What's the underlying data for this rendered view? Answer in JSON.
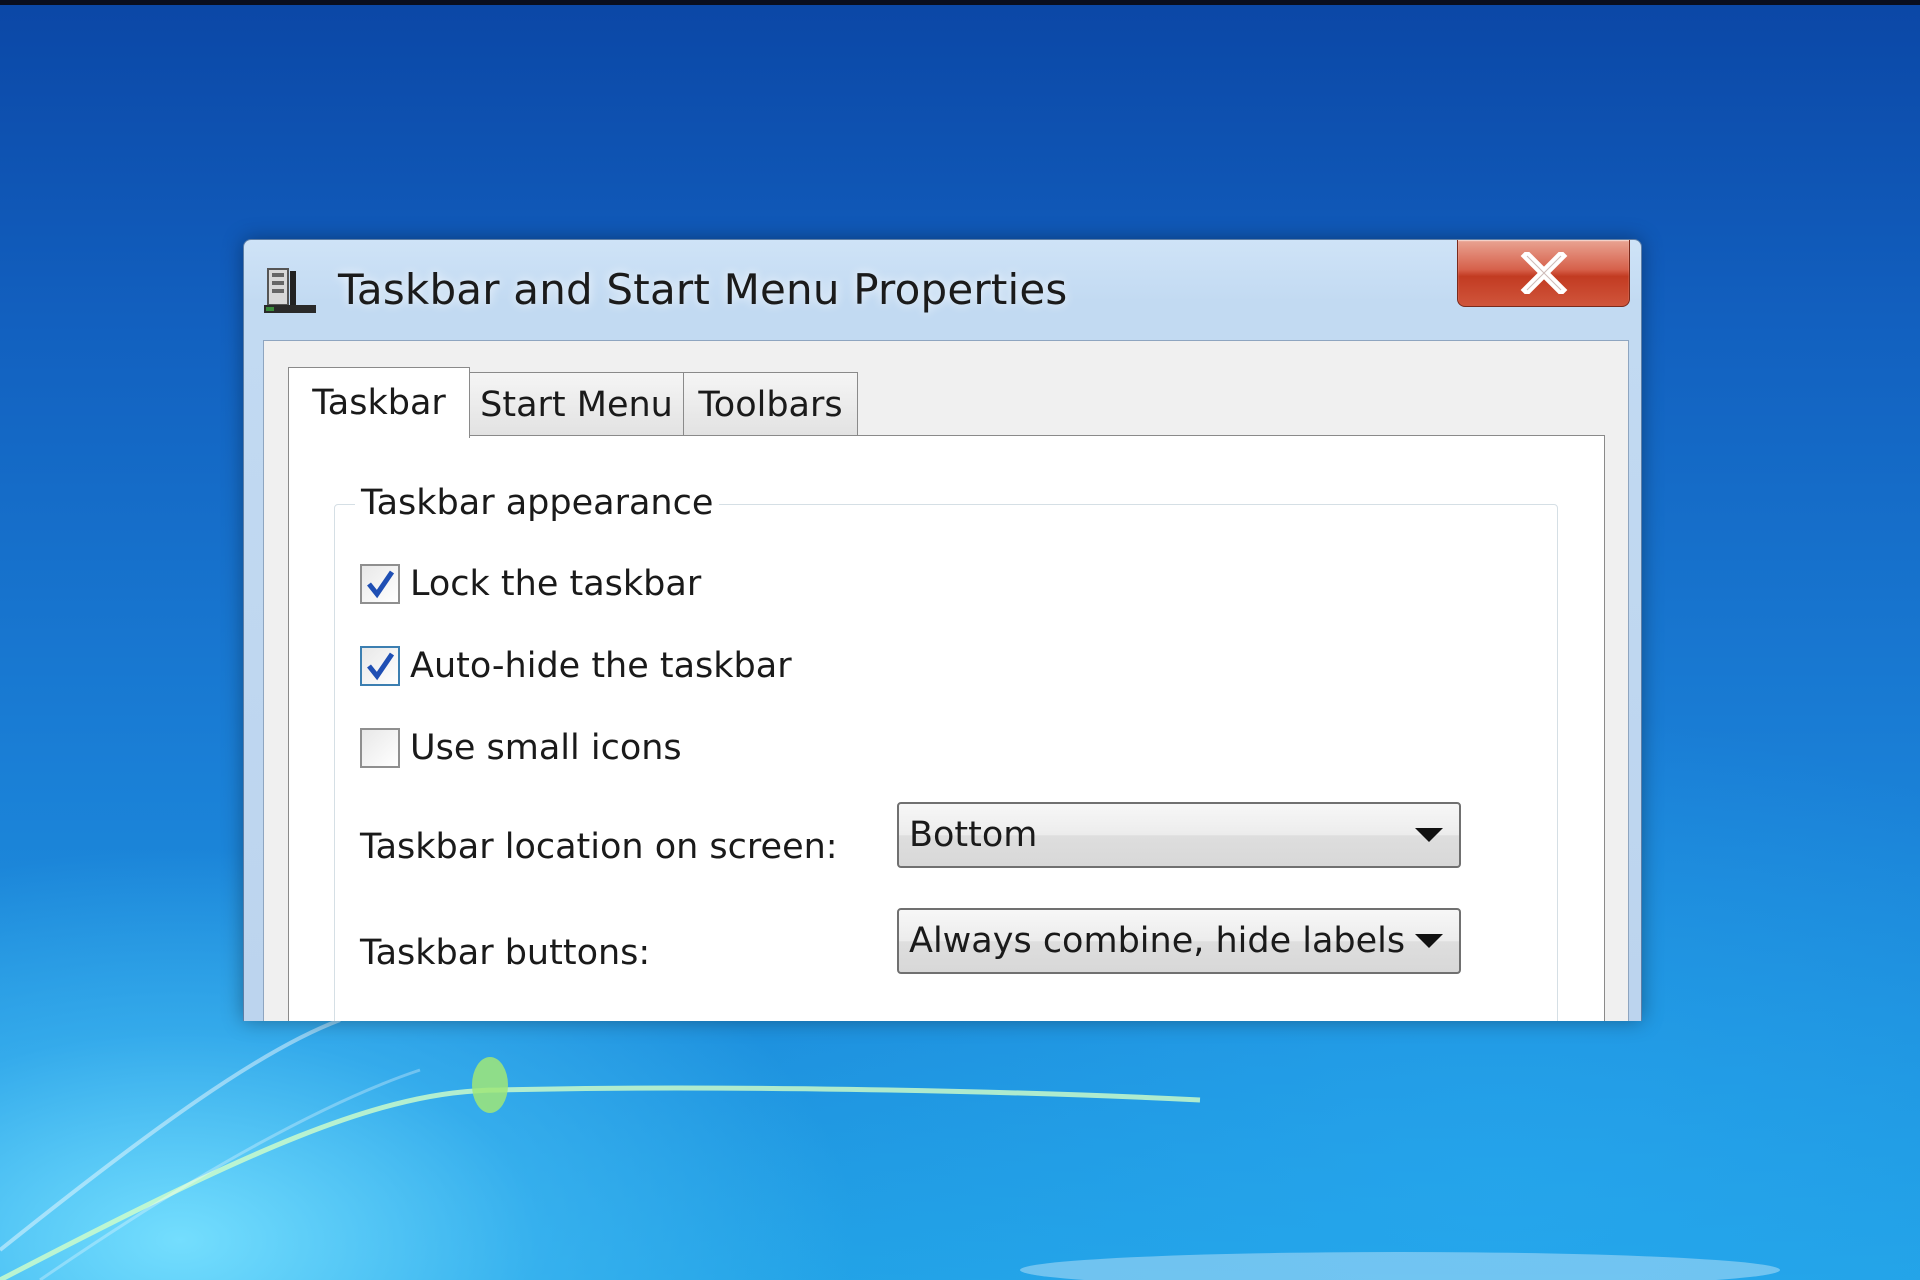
{
  "window": {
    "title": "Taskbar and Start Menu Properties",
    "close_label": "X"
  },
  "tabs": [
    {
      "label": "Taskbar",
      "active": true
    },
    {
      "label": "Start Menu",
      "active": false
    },
    {
      "label": "Toolbars",
      "active": false
    }
  ],
  "taskbar_appearance": {
    "group_label": "Taskbar appearance",
    "checkboxes": [
      {
        "label": "Lock the taskbar",
        "checked": true
      },
      {
        "label": "Auto-hide the taskbar",
        "checked": true
      },
      {
        "label": "Use small icons",
        "checked": false
      }
    ],
    "location_label": "Taskbar location on screen:",
    "location_value": "Bottom",
    "buttons_label": "Taskbar buttons:",
    "buttons_value": "Always combine, hide labels"
  },
  "colors": {
    "desktop_blue": "#1a7fd6",
    "close_red": "#c23b22",
    "check_blue": "#1f4fb4"
  }
}
